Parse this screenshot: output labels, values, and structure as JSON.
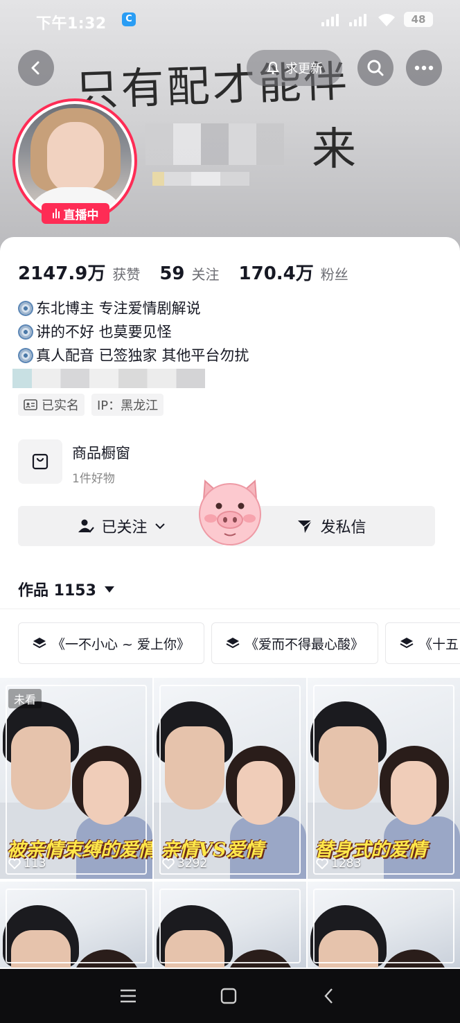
{
  "status_bar": {
    "time": "下午1:32",
    "app_badge": "C",
    "battery": "48"
  },
  "header": {
    "update_label": "求更新",
    "handwriting_line1": "只有配才能伴你",
    "handwriting_line2": "来",
    "live_label": "直播中"
  },
  "stats": [
    {
      "value": "2147.9万",
      "label": "获赞"
    },
    {
      "value": "59",
      "label": "关注"
    },
    {
      "value": "170.4万",
      "label": "粉丝"
    }
  ],
  "bio": [
    "东北博主 专注爱情剧解说",
    "讲的不好  也莫要见怪",
    "真人配音 已签独家 其他平台勿扰"
  ],
  "tags": {
    "verified": "已实名",
    "ip": "IP：黑龙江"
  },
  "shop": {
    "title": "商品橱窗",
    "subtitle": "1件好物"
  },
  "actions": {
    "follow": "已关注",
    "message": "发私信"
  },
  "works": {
    "label": "作品 1153"
  },
  "playlists": [
    "《一不小心 ~ 爱上你》",
    "《爱而不得最心酸》",
    "《十五"
  ],
  "videos": [
    {
      "caption": "被亲情束缚的爱情",
      "likes": "113",
      "unseen": "未看"
    },
    {
      "caption": "亲情VS爱情",
      "likes": "3292"
    },
    {
      "caption": "替身式的爱情",
      "likes": "1283"
    }
  ],
  "colors": {
    "accent": "#fe2c55",
    "text": "#161823",
    "secondary": "#6c6d73"
  }
}
